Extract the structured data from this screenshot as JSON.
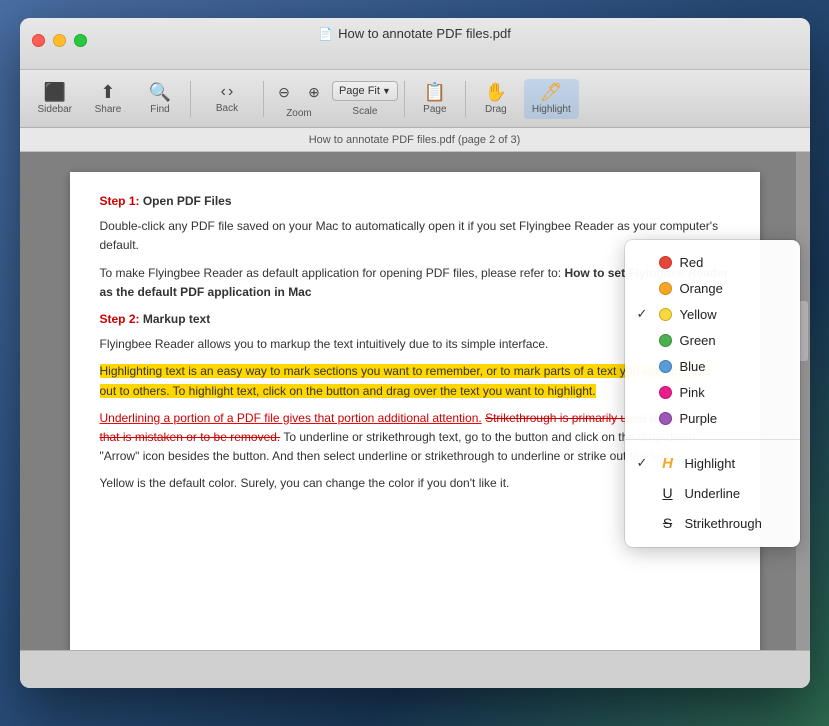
{
  "window": {
    "title": "How to annotate PDF files.pdf",
    "traffic_lights": {
      "close": "close",
      "minimize": "minimize",
      "maximize": "maximize"
    }
  },
  "toolbar": {
    "sidebar_label": "Sidebar",
    "share_label": "Share",
    "find_label": "Find",
    "back_label": "Back",
    "zoom_label": "Zoom",
    "scale_label": "Scale",
    "page_label": "Page",
    "drag_label": "Drag",
    "highlight_label": "Highlight",
    "page_fit_value": "Page Fit"
  },
  "page_info": "How to annotate PDF files.pdf (page 2 of 3)",
  "pdf": {
    "step1_heading": "Step 1: Open PDF Files",
    "step1_para1": "Double-click any PDF file saved on your Mac to automatically open it if you set Flyingbee Reader as your computer's default.",
    "step1_para2": "To make Flyingbee Reader as default application for opening PDF files, please refer to: ",
    "step1_para2_link": "How to set Flyingbee Reader as the default PDF application in Mac",
    "step2_heading": "Step 2: Markup text",
    "step2_para1": "Flyingbee Reader allows you to markup the text intuitively due to its simple interface.",
    "step2_para2_pre": "Highlighting text is an easy way to mark sections you want to remember, or to mark parts of a text you want to point out to others. To highlight text, click on the button and drag over the text you want to highlight.",
    "step2_para3_pre": "Underlining a portion of a PDF file gives that portion additional attention. ",
    "step2_para3_strike": "Strikethrough is primarily used to mark text that is mistaken or to be removed.",
    "step2_para3_post": " To underline or strikethrough text, go to the button and click on the drop-down \"Arrow\" icon besides the button. And then select underline or strikethrough to underline or strike out the text.",
    "step2_para4": "Yellow is the default color. Surely, you can change the color if you don't like it."
  },
  "dropdown": {
    "colors": [
      {
        "name": "Red",
        "color": "#e8453c",
        "checked": false
      },
      {
        "name": "Orange",
        "color": "#f5a623",
        "checked": false
      },
      {
        "name": "Yellow",
        "color": "#f8d940",
        "checked": true
      },
      {
        "name": "Green",
        "color": "#4caf50",
        "checked": false
      },
      {
        "name": "Blue",
        "color": "#5b9bd5",
        "checked": false
      },
      {
        "name": "Pink",
        "color": "#e91e8c",
        "checked": false
      },
      {
        "name": "Purple",
        "color": "#9b59b6",
        "checked": false
      }
    ],
    "annotations": [
      {
        "name": "Highlight",
        "icon": "highlight",
        "checked": true
      },
      {
        "name": "Underline",
        "icon": "underline",
        "checked": false
      },
      {
        "name": "Strikethrough",
        "icon": "strikethrough",
        "checked": false
      }
    ]
  }
}
